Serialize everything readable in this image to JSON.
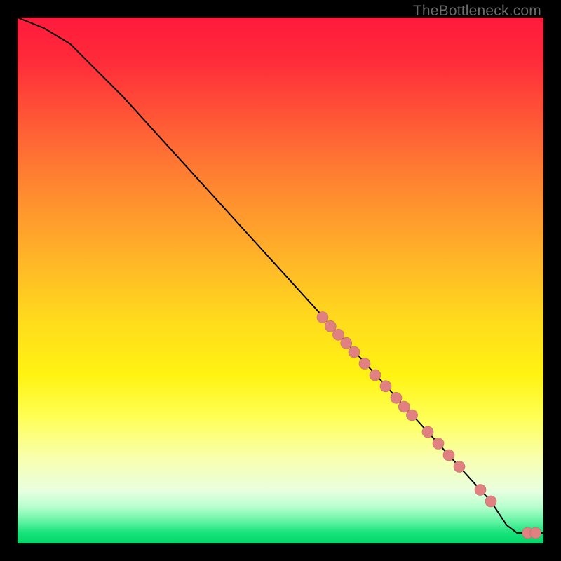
{
  "watermark": "TheBottleneck.com",
  "chart_data": {
    "type": "line",
    "title": "",
    "xlabel": "",
    "ylabel": "",
    "xlim": [
      0,
      100
    ],
    "ylim": [
      0,
      100
    ],
    "curve": {
      "x": [
        0,
        5,
        10,
        20,
        40,
        60,
        80,
        90,
        93,
        95,
        100
      ],
      "y": [
        100,
        98,
        95,
        85,
        63,
        41,
        19,
        8,
        3.5,
        2,
        2
      ]
    },
    "series": [
      {
        "name": "points",
        "x": [
          58,
          59.5,
          61,
          62.5,
          64,
          66,
          68,
          70,
          72,
          73.5,
          75,
          78,
          80,
          82,
          84,
          88,
          90,
          97,
          98.5
        ],
        "y": [
          43,
          41.3,
          39.7,
          38.1,
          36.4,
          34.2,
          32,
          29.9,
          27.7,
          26,
          24.4,
          21.2,
          19,
          16.8,
          14.6,
          10.2,
          8,
          2,
          2
        ]
      }
    ],
    "dot_radius": 8,
    "colors": {
      "curve": "#000000",
      "dot_fill": "#e08080",
      "dot_stroke": "#c06a6a",
      "gradient_top": "#ff1a3c",
      "gradient_mid": "#ffff55",
      "gradient_bottom": "#02d66a"
    }
  }
}
